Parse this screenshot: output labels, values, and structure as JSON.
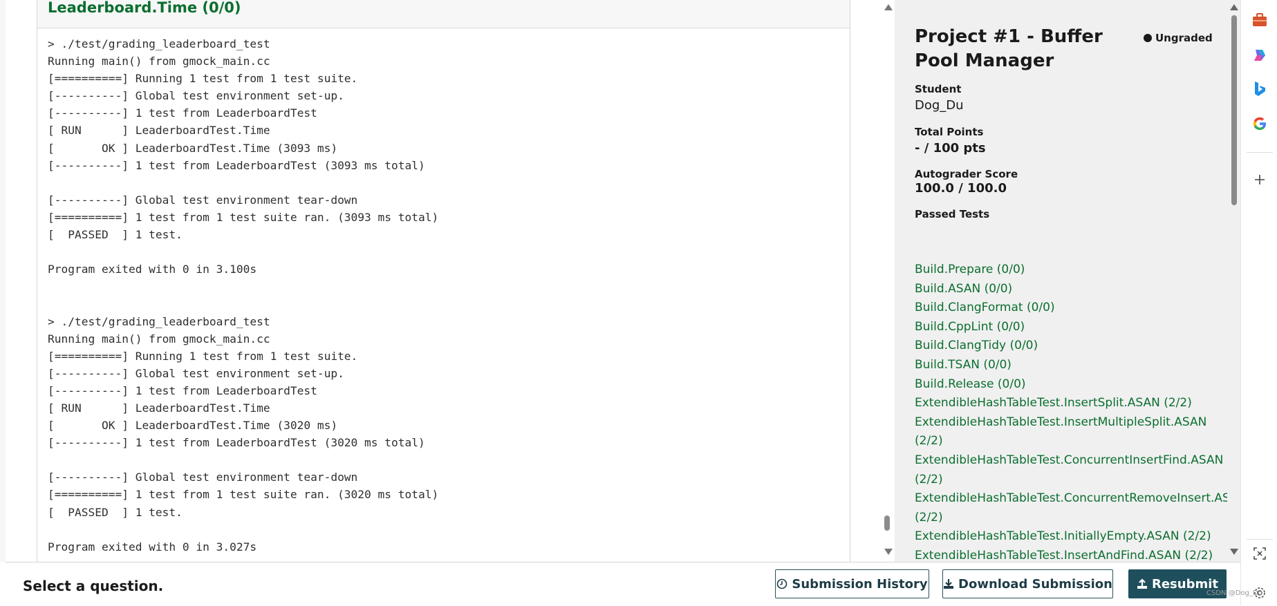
{
  "result": {
    "title": "Leaderboard.Time (0/0)",
    "output_lines": [
      "> ./test/grading_leaderboard_test",
      "Running main() from gmock_main.cc",
      "[==========] Running 1 test from 1 test suite.",
      "[----------] Global test environment set-up.",
      "[----------] 1 test from LeaderboardTest",
      "[ RUN      ] LeaderboardTest.Time",
      "[       OK ] LeaderboardTest.Time (3093 ms)",
      "[----------] 1 test from LeaderboardTest (3093 ms total)",
      "",
      "[----------] Global test environment tear-down",
      "[==========] 1 test from 1 test suite ran. (3093 ms total)",
      "[  PASSED  ] 1 test.",
      "",
      "Program exited with 0 in 3.100s",
      "",
      "",
      "> ./test/grading_leaderboard_test",
      "Running main() from gmock_main.cc",
      "[==========] Running 1 test from 1 test suite.",
      "[----------] Global test environment set-up.",
      "[----------] 1 test from LeaderboardTest",
      "[ RUN      ] LeaderboardTest.Time",
      "[       OK ] LeaderboardTest.Time (3020 ms)",
      "[----------] 1 test from LeaderboardTest (3020 ms total)",
      "",
      "[----------] Global test environment tear-down",
      "[==========] 1 test from 1 test suite ran. (3020 ms total)",
      "[  PASSED  ] 1 test.",
      "",
      "Program exited with 0 in 3.027s"
    ]
  },
  "sidebar": {
    "title": "Project #1 - Buffer Pool Manager",
    "status": "Ungraded",
    "student_label": "Student",
    "student_value": "Dog_Du",
    "total_points_label": "Total Points",
    "total_points_value": "- / 100 pts",
    "autograder_label": "Autograder Score",
    "autograder_value": "100.0 / 100.0",
    "passed_tests_label": "Passed Tests",
    "passed_tests": [
      "Build.Prepare (0/0)",
      "Build.ASAN (0/0)",
      "Build.ClangFormat (0/0)",
      "Build.CppLint (0/0)",
      "Build.ClangTidy (0/0)",
      "Build.TSAN (0/0)",
      "Build.Release (0/0)",
      "ExtendibleHashTableTest.InsertSplit.ASAN (2/2)",
      "ExtendibleHashTableTest.InsertMultipleSplit.ASAN",
      "(2/2)",
      "ExtendibleHashTableTest.ConcurrentInsertFind.ASAN",
      "(2/2)",
      "ExtendibleHashTableTest.ConcurrentRemoveInsert.ASAN",
      "(2/2)",
      "ExtendibleHashTableTest.InitiallyEmpty.ASAN (2/2)",
      "ExtendibleHashTableTest.InsertAndFind.ASAN (2/2)"
    ]
  },
  "footer": {
    "prompt": "Select a question.",
    "history_label": "Submission History",
    "download_label": "Download Submission",
    "resubmit_label": "Resubmit"
  },
  "watermark": "CSDN @Dog_Du",
  "edge_icons": [
    "briefcase-icon",
    "copilot-icon",
    "bing-icon",
    "google-icon",
    "add-icon",
    "screenshot-icon",
    "settings-icon"
  ],
  "colors": {
    "pass_green": "#0b6e2f",
    "primary_button": "#1f4f5c"
  }
}
